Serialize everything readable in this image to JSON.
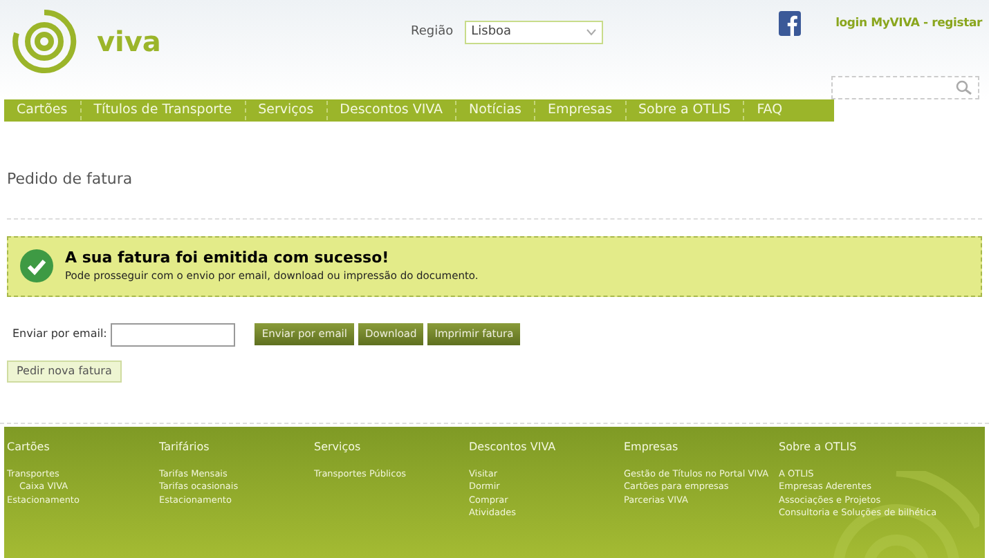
{
  "header": {
    "logo": "viva",
    "region_label": "Região",
    "region_value": "Lisboa",
    "account_link": "login MyVIVA - registar"
  },
  "nav": [
    "Cartões",
    "Títulos de Transporte",
    "Serviços",
    "Descontos VIVA",
    "Notícias",
    "Empresas",
    "Sobre a OTLIS",
    "FAQ"
  ],
  "page_title": "Pedido de fatura",
  "alert": {
    "title": "A sua fatura foi emitida com sucesso!",
    "message": "Pode prosseguir com o envio por email, download ou impressão do documento."
  },
  "email_form": {
    "label": "Enviar por email:",
    "buttons": [
      "Enviar por email",
      "Download",
      "Imprimir fatura"
    ]
  },
  "new_invoice_button": "Pedir nova fatura",
  "footer": [
    {
      "title": "Cartões",
      "links": [
        {
          "label": "Transportes",
          "children": [
            {
              "label": "Caixa VIVA"
            }
          ]
        },
        {
          "label": "Estacionamento"
        }
      ]
    },
    {
      "title": "Tarifários",
      "links": [
        {
          "label": "Tarifas Mensais"
        },
        {
          "label": "Tarifas ocasionais"
        },
        {
          "label": "Estacionamento"
        }
      ]
    },
    {
      "title": "Serviços",
      "links": [
        {
          "label": "Transportes Públicos"
        }
      ]
    },
    {
      "title": "Descontos VIVA",
      "links": [
        {
          "label": "Visitar"
        },
        {
          "label": "Dormir"
        },
        {
          "label": "Comprar"
        },
        {
          "label": "Atividades"
        }
      ]
    },
    {
      "title": "Empresas",
      "links": [
        {
          "label": "Gestão de Títulos no Portal VIVA"
        },
        {
          "label": "Cartões para empresas"
        },
        {
          "label": "Parcerias VIVA"
        }
      ]
    },
    {
      "title": "Sobre a OTLIS",
      "links": [
        {
          "label": "A OTLIS"
        },
        {
          "label": "Empresas Aderentes"
        },
        {
          "label": "Associações e Projetos"
        },
        {
          "label": "Consultoria e Soluções de bilhética"
        }
      ]
    }
  ]
}
